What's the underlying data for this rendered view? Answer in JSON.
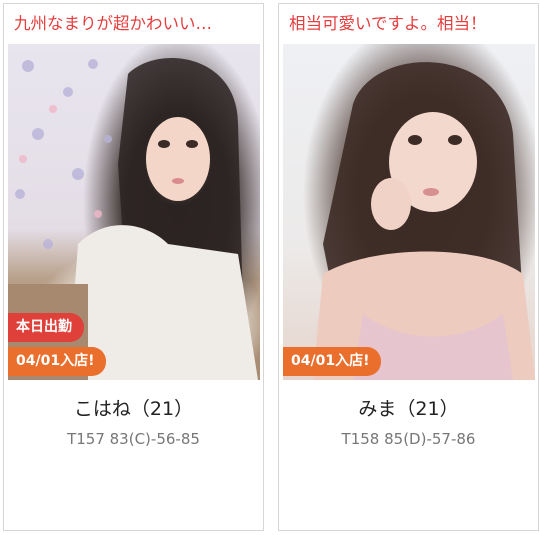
{
  "cards": [
    {
      "catch_copy": "九州なまりが超かわいい…",
      "badges": {
        "today": "本日出勤",
        "new_shop": "04/01入店!"
      },
      "name": "こはね（21）",
      "spec": "T157 83(C)-56-85"
    },
    {
      "catch_copy": "相当可愛いですよ。相当！",
      "badges": {
        "new_shop": "04/01入店!"
      },
      "name": "みま（21）",
      "spec": "T158 85(D)-57-86"
    }
  ],
  "colors": {
    "catch_text": "#e53d3d",
    "badge_today": "#e0403a",
    "badge_new": "#ea6f2c",
    "border": "#d6d6d6"
  }
}
